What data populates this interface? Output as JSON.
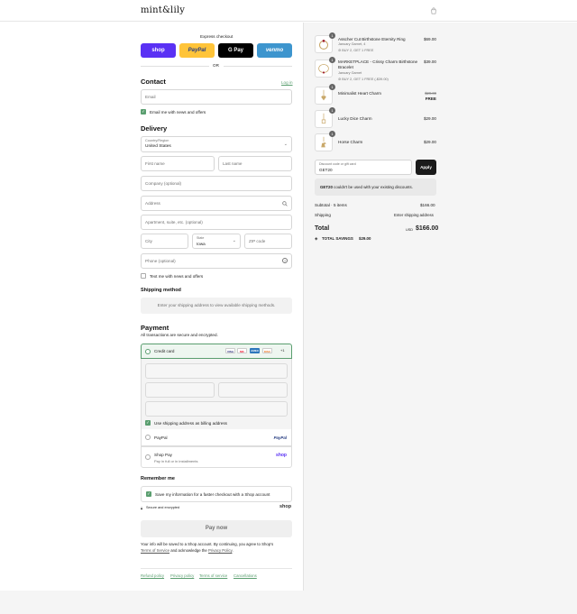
{
  "brand": {
    "logo_text": "mint&lily"
  },
  "express": {
    "label": "Express checkout",
    "buttons": [
      {
        "label": "shop",
        "bg": "#5a31f4",
        "fg": "#ffffff"
      },
      {
        "label": "PayPal",
        "bg": "#ffc439",
        "fg": "#253b80"
      },
      {
        "label": "G Pay",
        "bg": "#000000",
        "fg": "#ffffff"
      },
      {
        "label": "venmo",
        "bg": "#3d95ce",
        "fg": "#ffffff"
      }
    ],
    "or": "OR"
  },
  "contact": {
    "title": "Contact",
    "login": "Log in",
    "email_placeholder": "Email",
    "email_news": "Email me with news and offers"
  },
  "delivery": {
    "title": "Delivery",
    "country_label": "Country/Region",
    "country_value": "United States",
    "first_name": "First name",
    "last_name": "Last name",
    "company": "Company (optional)",
    "address": "Address",
    "apartment": "Apartment, suite, etc. (optional)",
    "city": "City",
    "state_label": "State",
    "state_value": "Iowa",
    "zip": "ZIP code",
    "phone": "Phone (optional)",
    "text_news": "Text me with news and offers"
  },
  "shipping": {
    "title": "Shipping method",
    "message": "Enter your shipping address to view available shipping methods."
  },
  "payment": {
    "title": "Payment",
    "subtitle": "All transactions are secure and encrypted.",
    "credit_card": "Credit card",
    "cards": [
      "VISA",
      "MC",
      "AMEX",
      "DISC"
    ],
    "more_cards": "+1",
    "billing_same": "Use shipping address as billing address",
    "paypal": "PayPal",
    "paypal_logo": "PayPal",
    "shop_pay": "Shop Pay",
    "shop_pay_sub": "Pay in full or in installments",
    "shop_logo": "shop"
  },
  "remember": {
    "title": "Remember me",
    "save_info": "Save my information for a faster checkout with a Shop account",
    "secure": "Secure and encrypted",
    "shop_logo": "shop"
  },
  "pay_now": "Pay now",
  "legal": {
    "line1": "Your info will be saved to a Shop account. By continuing, you agree to Shop's",
    "terms": "Terms of Service",
    "and_ack": " and acknowledge the ",
    "privacy": "Privacy Policy",
    "period": "."
  },
  "footer_links": [
    "Refund policy",
    "Privacy policy",
    "Terms of service",
    "Cancellations"
  ],
  "cart": {
    "items": [
      {
        "qty": "1",
        "name": "Asscher Cut Birthstone Eternity Ring",
        "sub1": "January Garnet, 4",
        "sub2": "BUY 2, GET 1 FREE",
        "price": "$69.00"
      },
      {
        "qty": "1",
        "name": "MARKETPLACE - Crissy Charm Birthstone",
        "name2": "Bracelet",
        "sub1": "January Garnet",
        "sub2": "BUY 2, GET 1 FREE (-$39.00)",
        "price": "$39.00"
      },
      {
        "qty": "1",
        "name": "Minimalist Heart Charm",
        "price_old": "$29.00",
        "price": "FREE"
      },
      {
        "qty": "1",
        "name": "Lucky Dice Charm",
        "price": "$29.00"
      },
      {
        "qty": "1",
        "name": "Horse Charm",
        "price": "$29.00"
      }
    ],
    "discount_label": "Discount code or gift card",
    "discount_value": "GET20",
    "apply": "Apply",
    "notice_code": "GET20",
    "notice_rest": " couldn't be used with your existing discounts.",
    "subtotal_label": "Subtotal · 5 items",
    "subtotal_value": "$166.00",
    "shipping_label": "Shipping",
    "shipping_value": "Enter shipping address",
    "total_label": "Total",
    "currency": "USD",
    "total_value": "$166.00",
    "savings_label": "TOTAL SAVINGS",
    "savings_value": "$29.00"
  }
}
